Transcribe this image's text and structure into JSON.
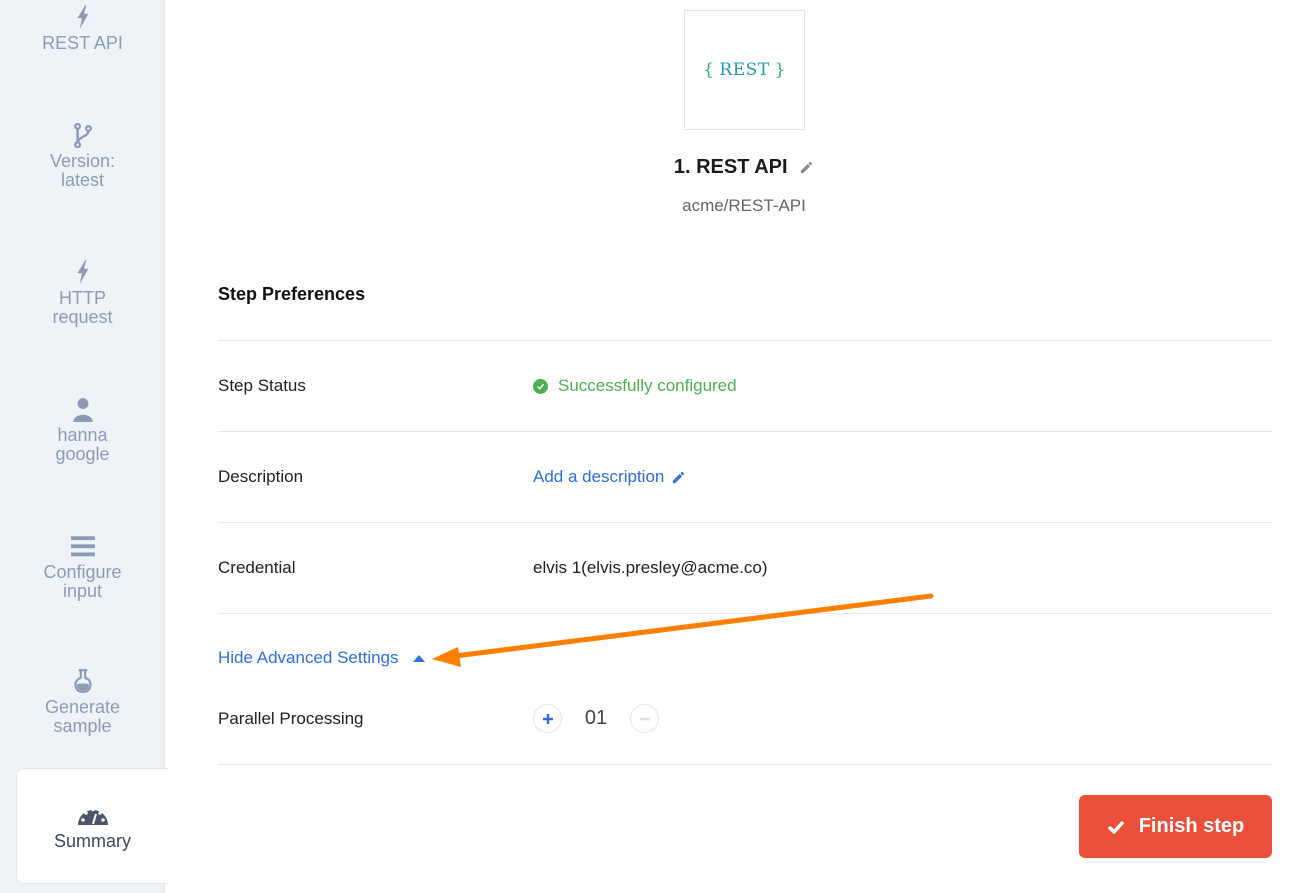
{
  "sidebar": {
    "items": [
      {
        "label": "REST API",
        "icon": "lightning-icon"
      },
      {
        "label": "Version: latest",
        "line1": "Version:",
        "line2": "latest",
        "icon": "git-branch-icon"
      },
      {
        "label": "HTTP request",
        "line1": "HTTP",
        "line2": "request",
        "icon": "lightning-icon"
      },
      {
        "label": "hanna google",
        "line1": "hanna",
        "line2": "google",
        "icon": "user-icon"
      },
      {
        "label": "Configure input",
        "line1": "Configure",
        "line2": "input",
        "icon": "menu-lines-icon"
      },
      {
        "label": "Generate sample",
        "line1": "Generate",
        "line2": "sample",
        "icon": "flask-icon"
      },
      {
        "label": "Summary",
        "icon": "dashboard-gauge-icon",
        "active": true
      }
    ]
  },
  "app_logo": {
    "brace_open": "{",
    "word": "REST",
    "brace_close": "}"
  },
  "step": {
    "title": "1. REST API",
    "subtitle": "acme/REST-API"
  },
  "preferences": {
    "title": "Step Preferences",
    "rows": [
      {
        "label": "Step Status",
        "value": "Successfully configured"
      },
      {
        "label": "Description",
        "value": "Add a description"
      },
      {
        "label": "Credential",
        "value": "elvis 1(elvis.presley@acme.co)"
      }
    ],
    "advanced_toggle": "Hide Advanced Settings",
    "parallel": {
      "label": "Parallel Processing",
      "value": "01"
    }
  },
  "finish_button": "Finish step",
  "colors": {
    "accent_link": "#2d6fe0",
    "success": "#4caf50",
    "primary_button": "#ea4f3a",
    "annotation_arrow": "#ff8000",
    "sidebar_bg": "#eef3f8"
  }
}
